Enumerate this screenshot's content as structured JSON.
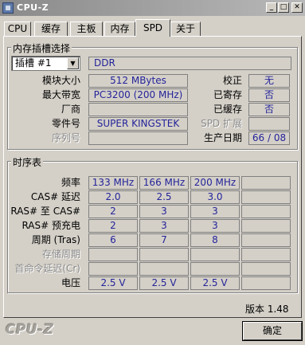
{
  "window": {
    "title": "CPU-Z"
  },
  "title_buttons": {
    "minimize": "_",
    "maximize": "□",
    "close": "✕"
  },
  "tabs": [
    {
      "label": "CPU"
    },
    {
      "label": "缓存"
    },
    {
      "label": "主板"
    },
    {
      "label": "内存"
    },
    {
      "label": "SPD",
      "active": true
    },
    {
      "label": "关于"
    }
  ],
  "slot_group": {
    "legend": "内存插槽选择",
    "slot_select": "插槽 #1",
    "memory_type": "DDR",
    "rows": [
      {
        "label": "模块大小",
        "value": "512 MBytes",
        "right_label": "校正",
        "right_value": "无"
      },
      {
        "label": "最大带宽",
        "value": "PC3200 (200 MHz)",
        "right_label": "已寄存",
        "right_value": "否"
      },
      {
        "label": "厂商",
        "value": "",
        "right_label": "已缓存",
        "right_value": "否"
      },
      {
        "label": "零件号",
        "value": "SUPER KINGSTEK",
        "right_label": "SPD 扩展",
        "right_value": ""
      },
      {
        "label": "序列号",
        "value": "",
        "right_label": "生产日期",
        "right_value": "66 / 08"
      }
    ]
  },
  "timing_group": {
    "legend": "时序表",
    "rows": [
      {
        "label": "频率",
        "values": [
          "133 MHz",
          "166 MHz",
          "200 MHz",
          ""
        ]
      },
      {
        "label": "CAS# 延迟",
        "values": [
          "2.0",
          "2.5",
          "3.0",
          ""
        ]
      },
      {
        "label": "RAS# 至 CAS#",
        "values": [
          "2",
          "3",
          "3",
          ""
        ]
      },
      {
        "label": "RAS# 预充电",
        "values": [
          "2",
          "3",
          "3",
          ""
        ]
      },
      {
        "label": "周期 (Tras)",
        "values": [
          "6",
          "7",
          "8",
          ""
        ]
      },
      {
        "label": "存储周期",
        "values": [
          "",
          "",
          "",
          ""
        ]
      },
      {
        "label": "首命令延迟(Cr)",
        "values": [
          "",
          "",
          "",
          ""
        ]
      },
      {
        "label": "电压",
        "values": [
          "2.5 V",
          "2.5 V",
          "2.5 V",
          ""
        ]
      }
    ]
  },
  "footer": {
    "version": "版本 1.48",
    "brand": "CPU-Z",
    "ok_button": "确定"
  },
  "colors": {
    "value_text": "#24249a",
    "face": "#d4d0c8"
  }
}
